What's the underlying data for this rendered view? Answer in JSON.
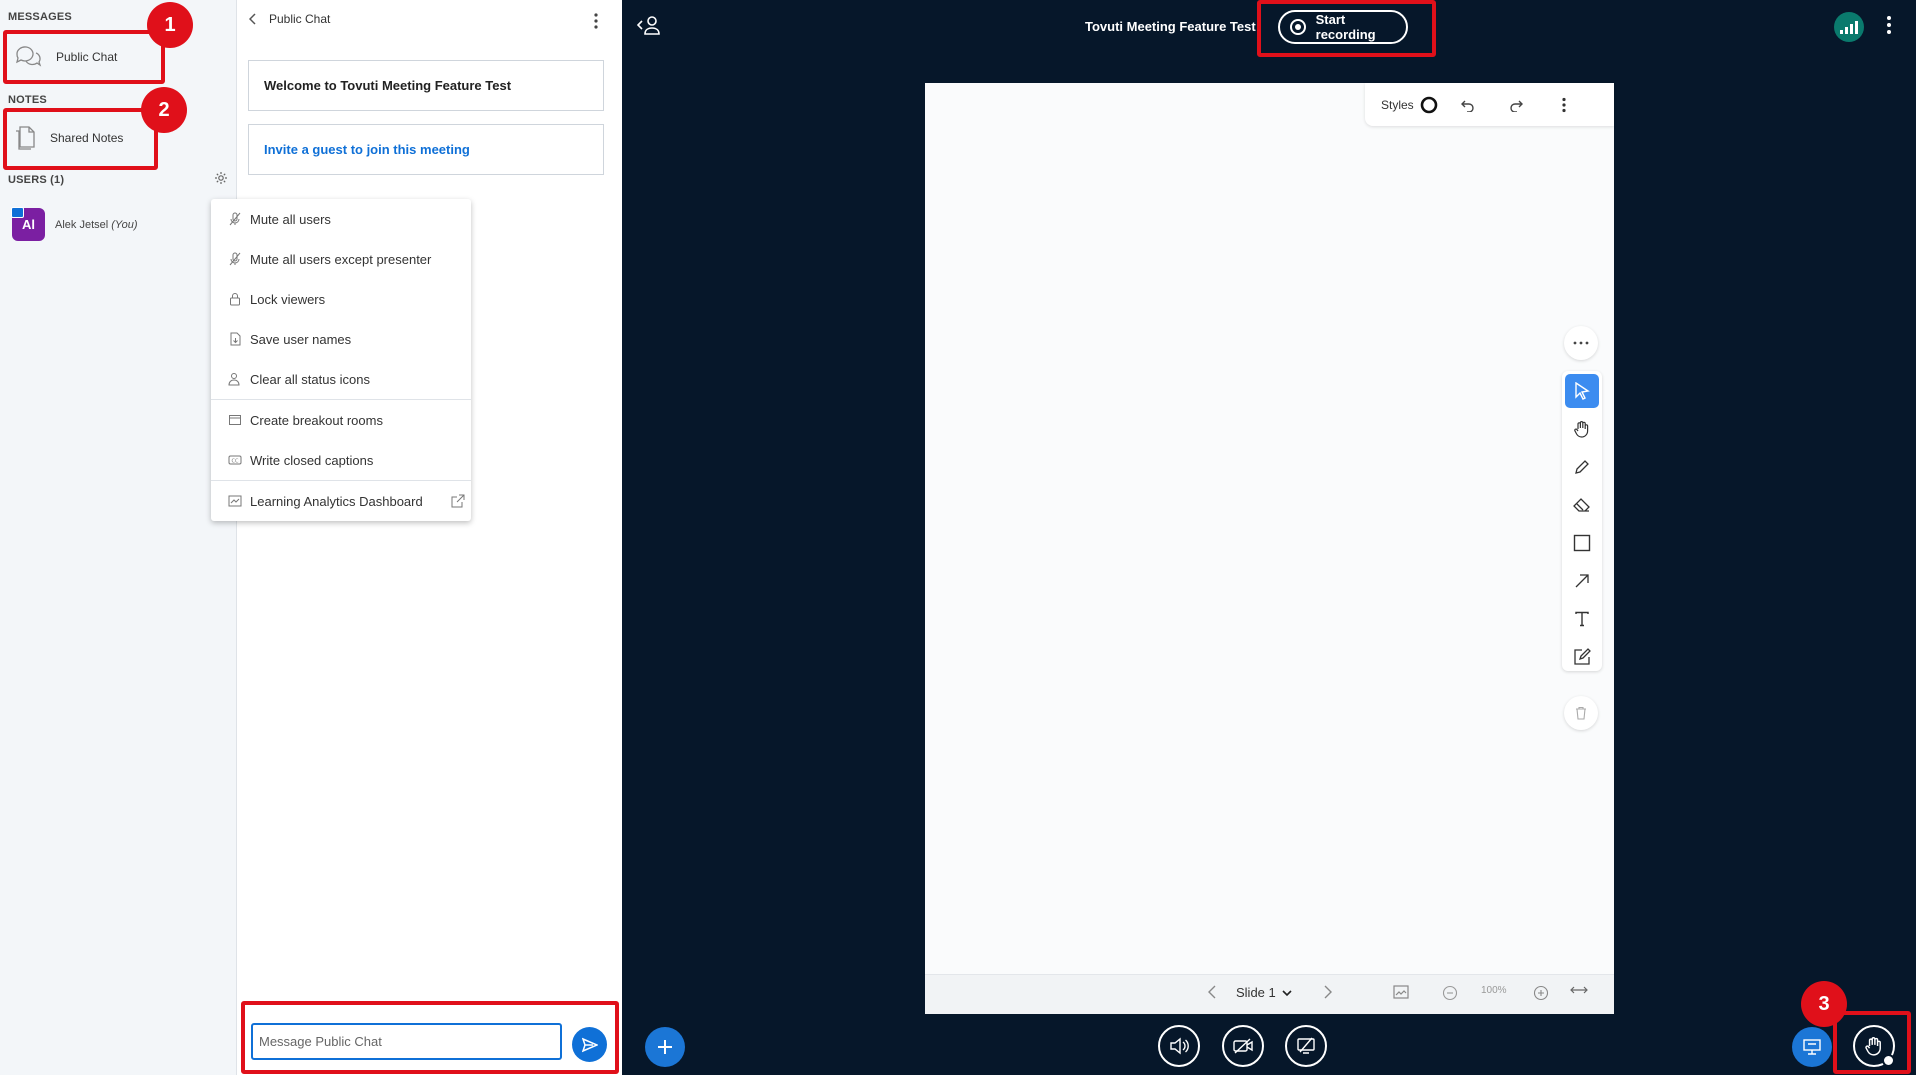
{
  "left_panel": {
    "messages_heading": "MESSAGES",
    "public_chat_label": "Public Chat",
    "notes_heading": "NOTES",
    "shared_notes_label": "Shared Notes",
    "users_heading": "USERS (1)",
    "user": {
      "initials": "Al",
      "name": "Alek Jetsel",
      "you_tag": "(You)"
    }
  },
  "badges": {
    "b1": "1",
    "b2": "2",
    "b3": "3"
  },
  "menu": {
    "items": [
      "Mute all users",
      "Mute all users except presenter",
      "Lock viewers",
      "Save user names",
      "Clear all status icons",
      "Create breakout rooms",
      "Write closed captions",
      "Learning Analytics Dashboard"
    ]
  },
  "chat": {
    "header": "Public Chat",
    "welcome": "Welcome to Tovuti Meeting Feature Test",
    "invite": "Invite a guest to join this meeting",
    "input_placeholder": "Message Public Chat"
  },
  "top_bar": {
    "meeting_title": "Tovuti Meeting Feature Test",
    "record_label": "Start recording"
  },
  "whiteboard": {
    "styles_label": "Styles",
    "slide_label": "Slide 1",
    "zoom": "100%"
  },
  "colors": {
    "accent": "#0f70d7",
    "highlight": "#e0101a",
    "main_bg": "#06172a",
    "avatar": "#7b1fa2",
    "connection": "#0a7a6d"
  }
}
